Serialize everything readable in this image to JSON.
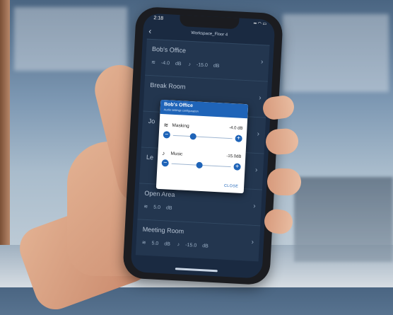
{
  "status_bar": {
    "time": "2:18",
    "icons": "▪▪ ◠ ▭"
  },
  "nav": {
    "back_icon": "chevron-left-icon",
    "back_glyph": "‹",
    "title": "Workspace_Floor 4"
  },
  "rooms": [
    {
      "name": "Bob's Office",
      "masking": "-4.0",
      "masking_unit": "dB",
      "music": "-15.0",
      "music_unit": "dB"
    },
    {
      "name": "Break Room",
      "masking": "",
      "masking_unit": "",
      "music": "",
      "music_unit": ""
    },
    {
      "name": "Jo",
      "masking": "",
      "masking_unit": "",
      "music": "",
      "music_unit": ""
    },
    {
      "name": "Le",
      "masking": "",
      "masking_unit": "",
      "music": "",
      "music_unit": ""
    },
    {
      "name": "Open Area",
      "masking": "5.0",
      "masking_unit": "dB",
      "music": "",
      "music_unit": ""
    },
    {
      "name": "Meeting Room",
      "masking": "5.0",
      "masking_unit": "dB",
      "music": "-15.0",
      "music_unit": "dB"
    }
  ],
  "icons": {
    "masking": "wave-icon",
    "music": "music-note-icon",
    "chevron": "chevron-right-icon"
  },
  "dialog": {
    "title": "Bob's Office",
    "subtitle": "Audio settings configuration",
    "masking": {
      "label": "Masking",
      "value": "-4.0 dB",
      "level": 0.33
    },
    "music": {
      "label": "Music",
      "value": "-15.0dB",
      "level": 0.47
    },
    "minus": "−",
    "plus": "+",
    "close_label": "CLOSE"
  },
  "colors": {
    "accent": "#1f64b8",
    "screen_bg": "#1a2a41",
    "room_bg": "#23364f"
  }
}
